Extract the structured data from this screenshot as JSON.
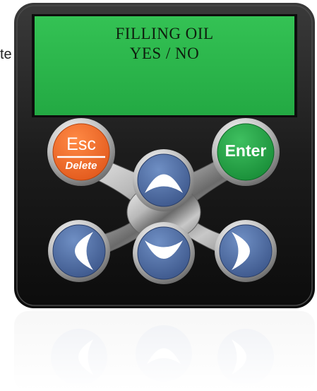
{
  "stray_text": "te",
  "display": {
    "line1": "FILLING OIL",
    "line2": "YES / NO"
  },
  "buttons": {
    "esc_label": "Esc",
    "delete_label": "Delete",
    "enter_label": "Enter",
    "up_icon": "arrow-up-icon",
    "down_icon": "arrow-down-icon",
    "left_icon": "arrow-left-icon",
    "right_icon": "arrow-right-icon"
  },
  "colors": {
    "lcd_green": "#29b34a",
    "esc_orange": "#f26a21",
    "enter_green": "#1d9a3f",
    "arrow_blue": "#4a6aa0",
    "bezel": "#1a1a1a"
  }
}
